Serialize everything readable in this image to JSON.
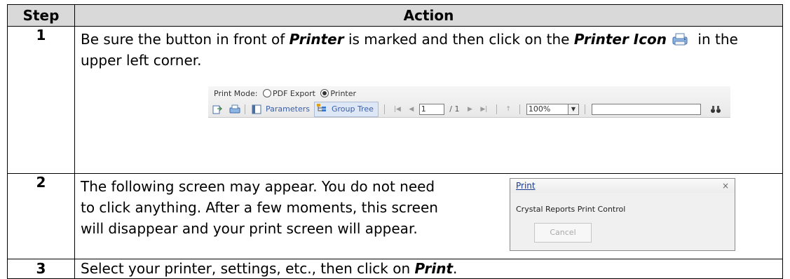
{
  "table": {
    "header": {
      "step": "Step",
      "action": "Action"
    },
    "rows": [
      {
        "step": "1",
        "parts": [
          "Be sure the button in front of ",
          "Printer",
          " is marked and then click on the ",
          "Printer Icon",
          " in the upper left corner."
        ]
      },
      {
        "step": "2",
        "text": "The following screen may appear. You do not need to click anything. After a few moments, this screen will disappear and your print screen will appear."
      },
      {
        "step": "3",
        "parts": [
          "Select your printer, settings, etc., then click on ",
          "Print",
          "."
        ]
      }
    ]
  },
  "toolbar": {
    "print_mode_label": "Print Mode:",
    "pdf_export": "PDF Export",
    "printer": "Printer",
    "selected_mode": "Printer",
    "parameters": "Parameters",
    "group_tree": "Group Tree",
    "page_value": "1",
    "page_total": "/ 1",
    "zoom_value": "100%",
    "search_value": ""
  },
  "dialog": {
    "title": "Print",
    "close": "×",
    "message": "Crystal Reports Print Control",
    "cancel": "Cancel"
  },
  "icons": [
    "printer-icon",
    "export-icon",
    "toggle-parameters-icon",
    "group-tree-icon",
    "first-page-icon",
    "previous-page-icon",
    "next-page-icon",
    "last-page-icon",
    "drill-up-icon",
    "search-binoculars-icon"
  ]
}
